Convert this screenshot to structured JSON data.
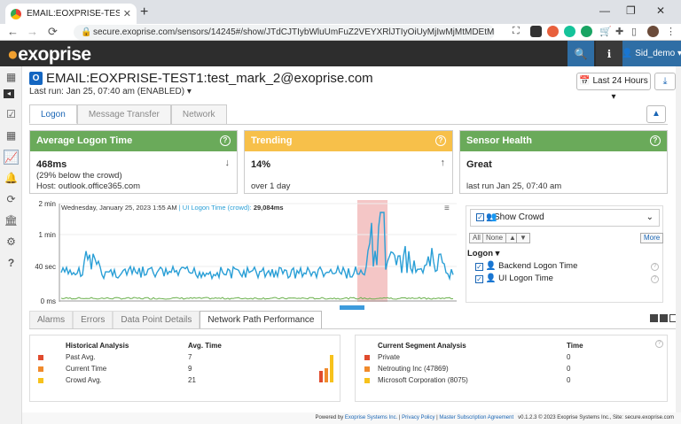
{
  "browser": {
    "tab_title": "EMAIL:EOXPRISE-TEST1:test_mar",
    "url": "secure.exoprise.com/sensors/14245#/show/JTdCJTIybWluUmFuZ2VEYXRlJTIyOiUyMjIwMjMtMDEtMjRUMTI6N..."
  },
  "header": {
    "logo": "exoprise",
    "user": "Sid_demo"
  },
  "sensor": {
    "title": "EMAIL:EOXPRISE-TEST1:test_mark_2@exoprise.com",
    "last_run": "Last run: Jan 25, 07:40 am (ENABLED)",
    "range_button": "Last 24 Hours"
  },
  "tabs": [
    "Logon",
    "Message Transfer",
    "Network"
  ],
  "cards": [
    {
      "title": "Average Logon Time",
      "color": "#6aaa5a",
      "value": "468ms",
      "line1": "(29% below the crowd)",
      "line2": "Host: outlook.office365.com"
    },
    {
      "title": "Trending",
      "color": "#f7c04a",
      "value": "14%",
      "line1": "over 1 day"
    },
    {
      "title": "Sensor Health",
      "color": "#6aaa5a",
      "value": "Great",
      "line1": "last run Jan 25, 07:40 am"
    }
  ],
  "chart_data": {
    "type": "line",
    "yticks": [
      "2 min",
      "1 min",
      "40 sec",
      "0 ms"
    ],
    "tooltip_date": "Wednesday, January 25, 2023 1:55 AM",
    "tooltip_series": "UI Logon Time (crowd):",
    "tooltip_value": "29,084ms",
    "series": [
      {
        "name": "UI Logon Time",
        "color": "#2a9fd6"
      },
      {
        "name": "Backend Logon Time",
        "color": "#6ab04c"
      }
    ],
    "highlight_color": "#f4c6c6"
  },
  "legend": {
    "show_crowd": "Show Crowd",
    "all": "All",
    "none": "None",
    "more": "More",
    "group": "Logon",
    "items": [
      "Backend Logon Time",
      "UI Logon Time"
    ]
  },
  "bottom_tabs": [
    "Alarms",
    "Errors",
    "Data Point Details",
    "Network Path Performance"
  ],
  "historical": {
    "h1": "Historical Analysis",
    "h2": "Avg. Time",
    "rows": [
      {
        "label": "Past Avg.",
        "value": "7",
        "color": "#e04b2e"
      },
      {
        "label": "Current Time",
        "value": "9",
        "color": "#f08a2c"
      },
      {
        "label": "Crowd Avg.",
        "value": "21",
        "color": "#f7c21c"
      }
    ]
  },
  "segment": {
    "h1": "Current Segment Analysis",
    "h2": "Time",
    "rows": [
      {
        "label": "Private",
        "value": "0",
        "color": "#e04b2e"
      },
      {
        "label": "Netrouting Inc (47869)",
        "value": "0",
        "color": "#f08a2c"
      },
      {
        "label": "Microsoft Corporation (8075)",
        "value": "0",
        "color": "#f7c21c"
      }
    ]
  },
  "footer": {
    "powered": "Powered by",
    "company": "Exoprise Systems Inc.",
    "privacy": "Privacy Policy",
    "msa": "Master Subscription Agreement",
    "version": "v0.1.2.3 © 2023 Exoprise Systems Inc., Site: secure.exoprise.com"
  }
}
